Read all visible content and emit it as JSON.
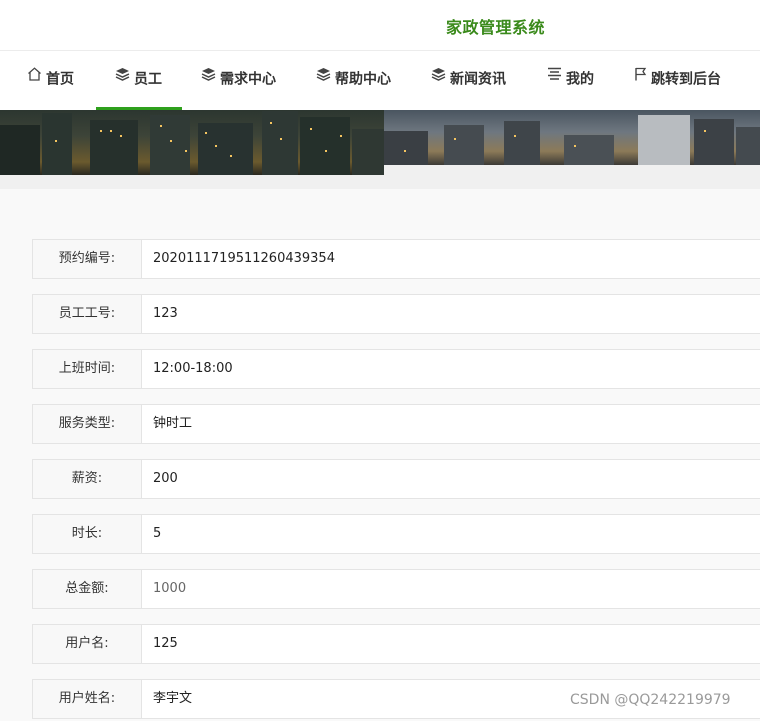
{
  "header": {
    "site_title": "家政管理系统"
  },
  "nav": [
    {
      "label": "首页",
      "icon": "home-icon"
    },
    {
      "label": "员工",
      "icon": "layers-icon",
      "active": true
    },
    {
      "label": "需求中心",
      "icon": "layers-icon"
    },
    {
      "label": "帮助中心",
      "icon": "layers-icon"
    },
    {
      "label": "新闻资讯",
      "icon": "layers-icon"
    },
    {
      "label": "我的",
      "icon": "list-icon"
    },
    {
      "label": "跳转到后台",
      "icon": "flag-icon"
    }
  ],
  "form": {
    "rows": [
      {
        "label": "预约编号:",
        "value": "20201117195112604393​54"
      },
      {
        "label": "员工工号:",
        "value": "123"
      },
      {
        "label": "上班时间:",
        "value": "12:00-18:00"
      },
      {
        "label": "服务类型:",
        "value": "钟时工"
      },
      {
        "label": "薪资:",
        "value": "200"
      },
      {
        "label": "时长:",
        "value": "5"
      },
      {
        "label": "总金额:",
        "value": "1000"
      },
      {
        "label": "用户名:",
        "value": "125"
      },
      {
        "label": "用户姓名:",
        "value": "李宇文"
      }
    ]
  },
  "watermark": "CSDN @QQ242219979",
  "colors": {
    "accent": "#2fa01c",
    "title": "#3a8a1b"
  }
}
